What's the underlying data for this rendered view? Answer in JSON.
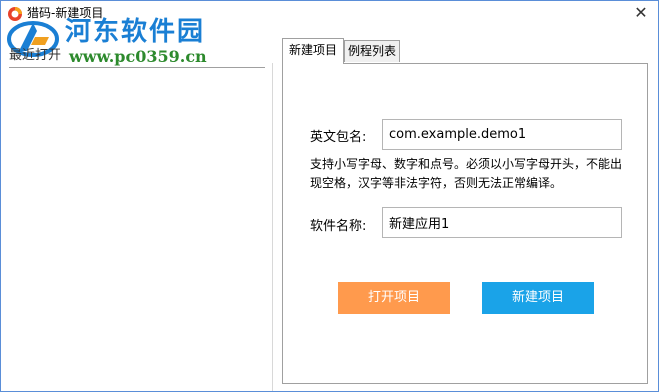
{
  "window": {
    "title": "猎码-新建项目",
    "close_glyph": "✕"
  },
  "watermark": {
    "site_name": "河东软件园",
    "url": "www.pc0359.cn"
  },
  "left": {
    "recent_label": "最近打开"
  },
  "tabs": [
    {
      "label": "新建项目",
      "active": true
    },
    {
      "label": "例程列表",
      "active": false
    }
  ],
  "form": {
    "package_label": "英文包名:",
    "package_value": "com.example.demo1",
    "hint": "支持小写字母、数字和点号。必须以小写字母开头，不能出现空格，汉字等非法字符，否则无法正常编译。",
    "name_label": "软件名称:",
    "name_value": "新建应用1"
  },
  "buttons": {
    "open": "打开项目",
    "create": "新建项目"
  },
  "colors": {
    "open_button": "#ff9a4d",
    "create_button": "#1aa3e8",
    "window_border": "#5a8ed8"
  }
}
